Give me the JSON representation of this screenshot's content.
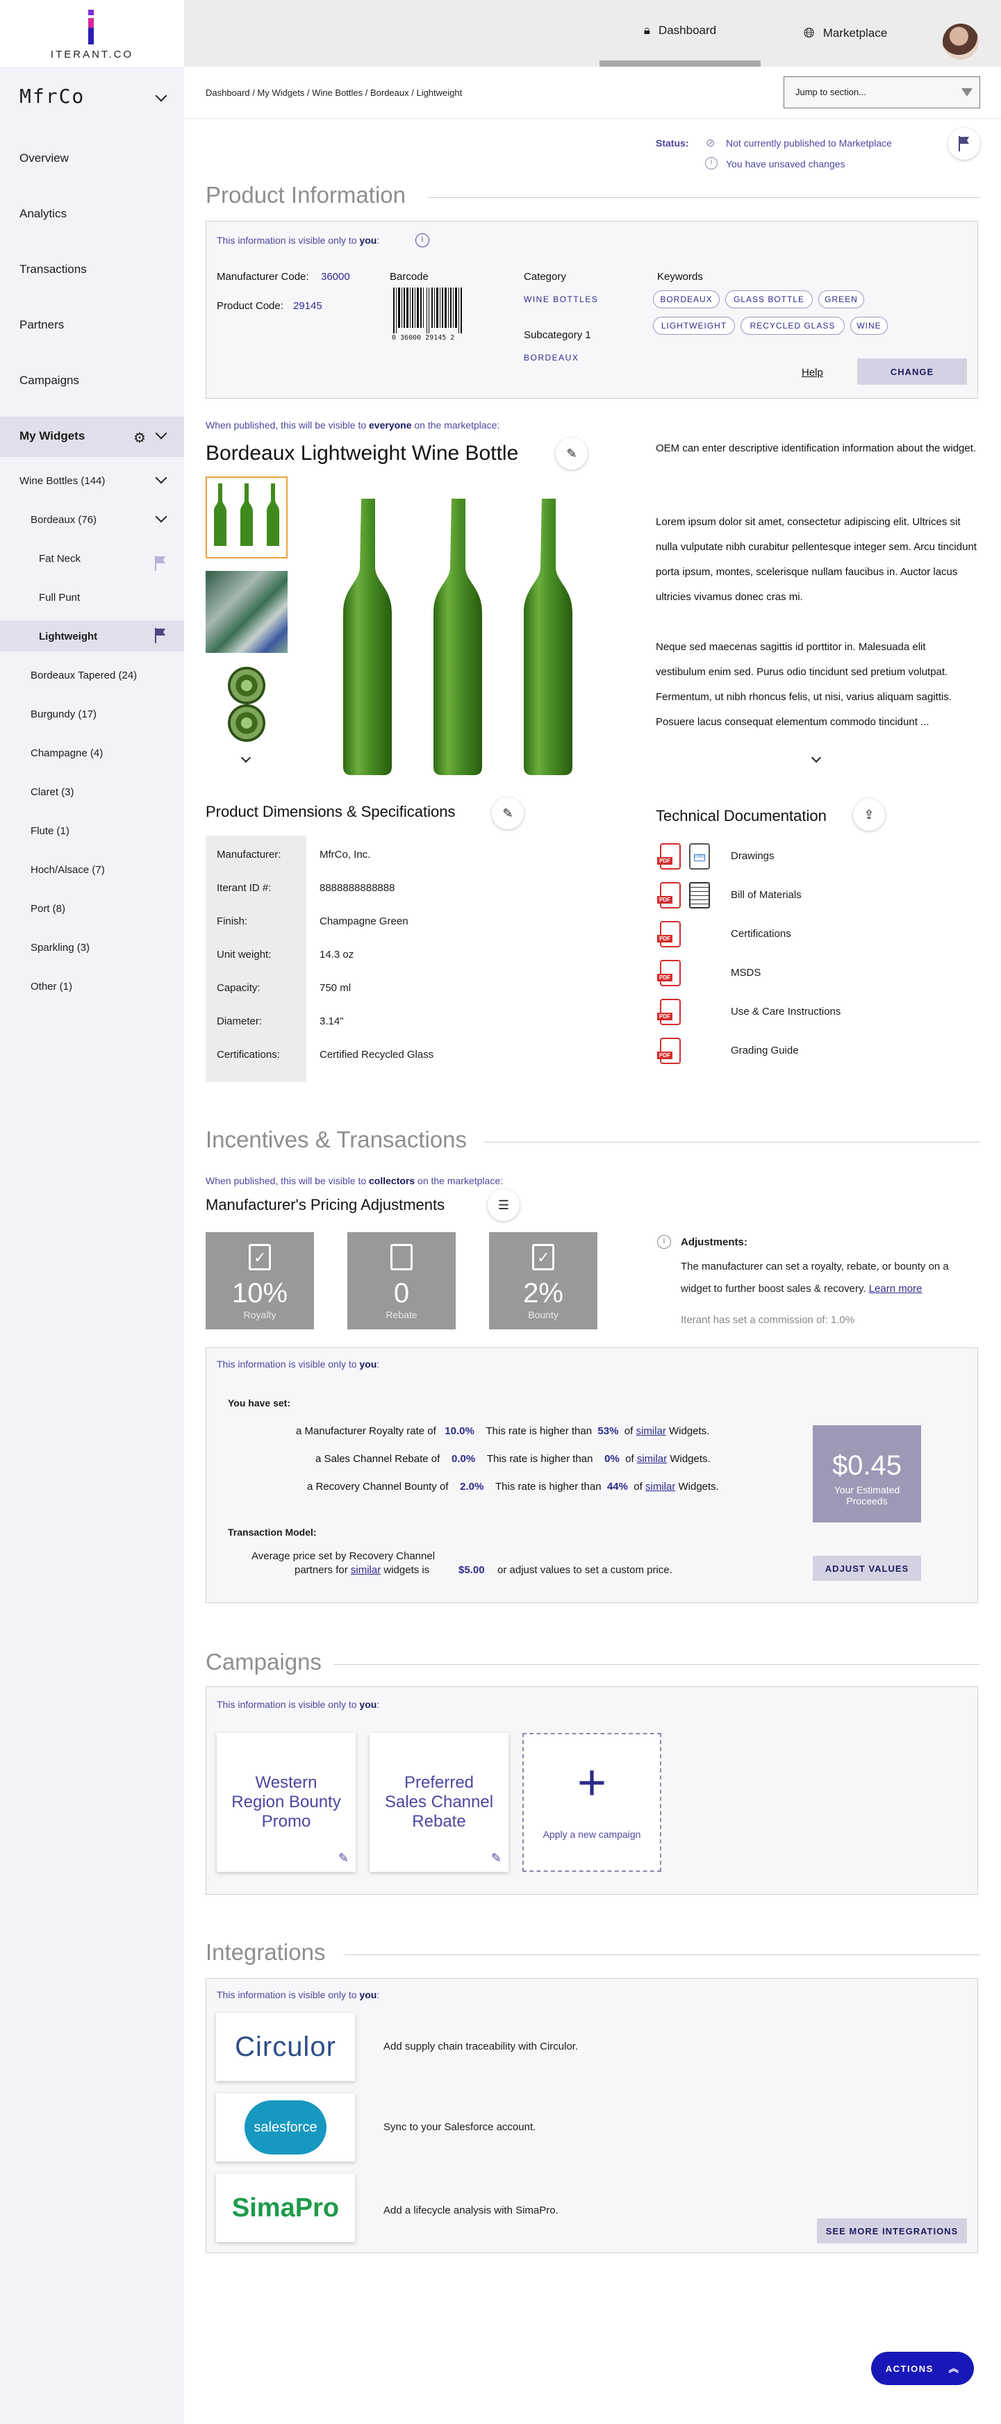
{
  "brand": {
    "logo_text": "ITERANT.CO",
    "company": "MfrCo"
  },
  "nav": {
    "items": [
      "Overview",
      "Analytics",
      "Transactions",
      "Partners",
      "Campaigns",
      "My Widgets"
    ],
    "widget_tree": [
      "Wine Bottles (144)",
      "Bordeaux (76)",
      "Fat Neck",
      "Full Punt",
      "Lightweight",
      "Bordeaux Tapered (24)",
      "Burgundy (17)",
      "Champagne (4)",
      "Claret (3)",
      "Flute (1)",
      "Hoch/Alsace (7)",
      "Port (8)",
      "Sparkling (3)",
      "Other (1)"
    ]
  },
  "topbar": {
    "tabs": [
      "Dashboard",
      "Marketplace"
    ]
  },
  "breadcrumb": "Dashboard / My Widgets / Wine Bottles / Bordeaux / Lightweight",
  "jump": {
    "label": "Jump to section..."
  },
  "status": {
    "label": "Status:",
    "line1": "Not currently published to Marketplace",
    "line2": "You have unsaved changes"
  },
  "product_info": {
    "heading": "Product Information",
    "visible_note": "This information is visible only to ",
    "you": "you",
    "mfr_code_label": "Manufacturer Code:",
    "mfr_code": "36000",
    "product_code_label": "Product Code:",
    "product_code": "29145",
    "barcode_label": "Barcode",
    "barcode_text": "0  36000  29145  2",
    "category_label": "Category",
    "category": "WINE BOTTLES",
    "subcategory_label": "Subcategory 1",
    "subcategory": "BORDEAUX",
    "keywords_label": "Keywords",
    "keywords": [
      "BORDEAUX",
      "GLASS BOTTLE",
      "GREEN",
      "LIGHTWEIGHT",
      "RECYCLED GLASS",
      "WINE"
    ],
    "help": "Help",
    "change": "CHANGE"
  },
  "listing": {
    "publish_note_a": "When published, this will be visible to ",
    "everyone": "everyone",
    "publish_note_b": " on the marketplace:",
    "title": "Bordeaux Lightweight Wine Bottle",
    "desc1": "OEM can enter descriptive identification information about the widget.",
    "desc2": "Lorem ipsum dolor sit amet, consectetur adipiscing elit. Ultrices sit nulla vulputate nibh curabitur pellentesque integer sem. Arcu tincidunt porta ipsum, montes, scelerisque nullam faucibus in. Auctor lacus ultricies vivamus donec cras mi.",
    "desc3": "Neque sed maecenas sagittis id porttitor in. Malesuada elit vestibulum enim sed. Purus odio tincidunt sed pretium volutpat. Fermentum, ut nibh rhoncus felis, ut nisi, varius aliquam sagittis. Posuere lacus consequat elementum commodo tincidunt ..."
  },
  "specs": {
    "heading": "Product Dimensions & Specifications",
    "rows": [
      [
        "Manufacturer:",
        "MfrCo, Inc."
      ],
      [
        "Iterant ID #:",
        "8888888888888"
      ],
      [
        "Finish:",
        "Champagne Green"
      ],
      [
        "Unit weight:",
        "14.3 oz"
      ],
      [
        "Capacity:",
        "750 ml"
      ],
      [
        "Diameter:",
        "3.14\""
      ],
      [
        "Certifications:",
        "Certified Recycled Glass"
      ]
    ]
  },
  "docs": {
    "heading": "Technical Documentation",
    "items": [
      "Drawings",
      "Bill of Materials",
      "Certifications",
      "MSDS",
      "Use & Care Instructions",
      "Grading Guide"
    ]
  },
  "incentives": {
    "heading": "Incentives & Transactions",
    "note_a": "When published, this will be visible to ",
    "collectors": "collectors",
    "note_b": " on the marketplace:",
    "sub": "Manufacturer's Pricing Adjustments",
    "cards": [
      {
        "value": "10%",
        "label": "Royalty"
      },
      {
        "value": "0",
        "label": "Rebate"
      },
      {
        "value": "2%",
        "label": "Bounty"
      }
    ],
    "adj_title": "Adjustments:",
    "adj_text": "The manufacturer can set a royalty, rebate, or bounty on a widget to further boost sales & recovery. ",
    "learn": "Learn more",
    "commission": "Iterant has set a commission of: 1.0%",
    "private_note": "This information is visible only to ",
    "you": "you",
    "you_set": "You have set:",
    "rates": [
      {
        "label": "a Manufacturer Royalty rate of",
        "value": "10.0%",
        "cmp": "53%"
      },
      {
        "label": "a Sales Channel Rebate of",
        "value": "0.0%",
        "cmp": "0%"
      },
      {
        "label": "a Recovery Channel Bounty of",
        "value": "2.0%",
        "cmp": "44%"
      }
    ],
    "higher": "This rate is higher than",
    "of": "of",
    "similar": "similar",
    "widgets": "Widgets.",
    "proceeds": "$0.45",
    "proceeds_label": "Your Estimated Proceeds",
    "model_title": "Transaction Model:",
    "model_a": "Average price set by Recovery Channel",
    "model_b": "partners for ",
    "model_c": " widgets is",
    "price": "$5.00",
    "model_d": "or adjust values to set a custom price.",
    "adjust": "ADJUST VALUES"
  },
  "campaigns": {
    "heading": "Campaigns",
    "note": "This information is visible only to ",
    "you": "you",
    "items": [
      "Western Region Bounty Promo",
      "Preferred Sales Channel Rebate"
    ],
    "add": "Apply a new campaign"
  },
  "integrations": {
    "heading": "Integrations",
    "note": "This information is visible only to ",
    "you": "you",
    "items": [
      {
        "logo": "Circulor",
        "text": "Add supply chain traceability with Circulor."
      },
      {
        "logo": "salesforce",
        "text": "Sync to your Salesforce account."
      },
      {
        "logo": "SimaPro",
        "text": "Add a lifecycle analysis with SimaPro."
      }
    ],
    "more": "SEE MORE INTEGRATIONS"
  },
  "actions": "ACTIONS",
  "colors": {
    "accent": "#2d2a8c",
    "actions": "#1a17b8",
    "pdf": "#d42d2d",
    "bottle": "#3f8a1e"
  }
}
